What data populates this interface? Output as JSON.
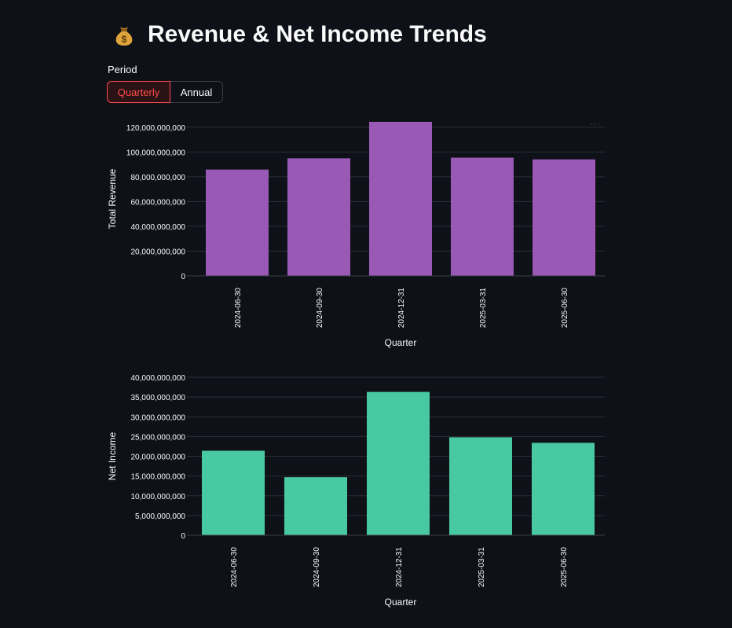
{
  "page": {
    "title": "Revenue & Net Income Trends",
    "title_icon": "money-bag-icon",
    "period_label": "Period",
    "period_options": [
      "Quarterly",
      "Annual"
    ],
    "period_selected": "Quarterly",
    "accent_color": "#ff4b4b"
  },
  "chart_data": [
    {
      "type": "bar",
      "categories": [
        "2024-06-30",
        "2024-09-30",
        "2024-12-31",
        "2025-03-31",
        "2025-06-30"
      ],
      "values": [
        85800000000,
        94900000000,
        124300000000,
        95400000000,
        94000000000
      ],
      "xlabel": "Quarter",
      "ylabel": "Total Revenue",
      "ylim": [
        0,
        124300000000
      ],
      "yticks": [
        0,
        20000000000,
        40000000000,
        60000000000,
        80000000000,
        100000000000,
        120000000000
      ],
      "ytick_labels": [
        "0",
        "20,000,000,000",
        "40,000,000,000",
        "60,000,000,000",
        "80,000,000,000",
        "100,000,000,000",
        "120,000,000,000"
      ],
      "color": "#9b59b6",
      "grid": true
    },
    {
      "type": "bar",
      "categories": [
        "2024-06-30",
        "2024-09-30",
        "2024-12-31",
        "2025-03-31",
        "2025-06-30"
      ],
      "values": [
        21400000000,
        14700000000,
        36300000000,
        24800000000,
        23400000000
      ],
      "xlabel": "Quarter",
      "ylabel": "Net Income",
      "ylim": [
        0,
        40000000000
      ],
      "yticks": [
        0,
        5000000000,
        10000000000,
        15000000000,
        20000000000,
        25000000000,
        30000000000,
        35000000000,
        40000000000
      ],
      "ytick_labels": [
        "0",
        "5,000,000,000",
        "10,000,000,000",
        "15,000,000,000",
        "20,000,000,000",
        "25,000,000,000",
        "30,000,000,000",
        "35,000,000,000",
        "40,000,000,000"
      ],
      "color": "#48c9a2",
      "grid": true
    }
  ]
}
